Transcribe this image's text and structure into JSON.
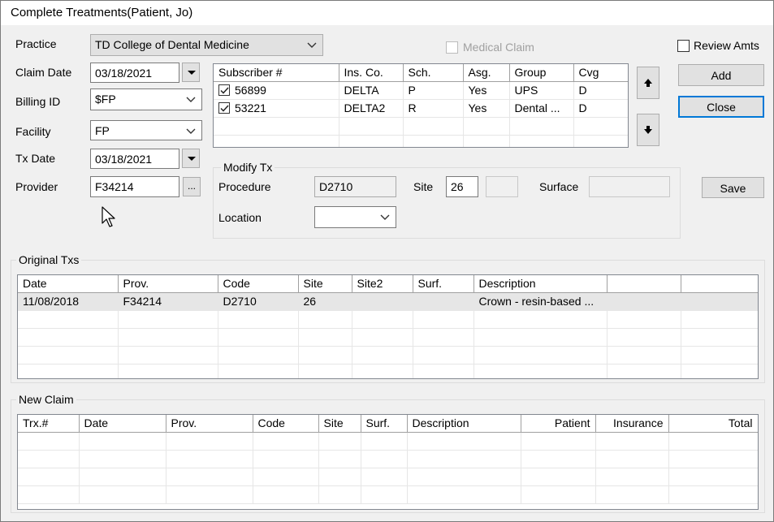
{
  "window": {
    "title": "Complete Treatments(Patient, Jo)"
  },
  "form": {
    "practice_label": "Practice",
    "practice_value": "TD College of Dental Medicine",
    "claim_date_label": "Claim Date",
    "claim_date_value": "03/18/2021",
    "billing_id_label": "Billing ID",
    "billing_id_value": "$FP",
    "facility_label": "Facility",
    "facility_value": "FP",
    "tx_date_label": "Tx Date",
    "tx_date_value": "03/18/2021",
    "provider_label": "Provider",
    "provider_value": "F34214",
    "provider_browse": "..."
  },
  "medical_claim": {
    "label": "Medical Claim",
    "checked": false,
    "enabled": false
  },
  "review_amts": {
    "label": "Review Amts",
    "checked": false
  },
  "buttons": {
    "add": "Add",
    "close": "Close",
    "save": "Save"
  },
  "subscribers": {
    "columns": [
      "Subscriber #",
      "Ins. Co.",
      "Sch.",
      "Asg.",
      "Group",
      "Cvg"
    ],
    "rows": [
      {
        "checked": true,
        "cells": [
          "56899",
          "DELTA",
          "P",
          "Yes",
          "UPS",
          "D"
        ]
      },
      {
        "checked": true,
        "cells": [
          "53221",
          "DELTA2",
          "R",
          "Yes",
          "Dental ...",
          "D"
        ]
      }
    ]
  },
  "modify_tx": {
    "title": "Modify Tx",
    "procedure_label": "Procedure",
    "procedure_value": "D2710",
    "site_label": "Site",
    "site_value": "26",
    "site2_value": "",
    "surface_label": "Surface",
    "surface_value": "",
    "location_label": "Location",
    "location_value": ""
  },
  "original_txs": {
    "title": "Original Txs",
    "columns": [
      "Date",
      "Prov.",
      "Code",
      "Site",
      "Site2",
      "Surf.",
      "Description",
      "",
      ""
    ],
    "rows": [
      [
        "11/08/2018",
        "F34214",
        "D2710",
        "26",
        "",
        "",
        "Crown - resin-based ...",
        "",
        ""
      ]
    ]
  },
  "new_claim": {
    "title": "New Claim",
    "columns": [
      "Trx.#",
      "Date",
      "Prov.",
      "Code",
      "Site",
      "Surf.",
      "Description",
      "Patient",
      "Insurance",
      "Total"
    ],
    "rows": []
  },
  "icons": {
    "chevron": "chevron-down-icon",
    "up": "arrow-up-icon",
    "down": "arrow-down-icon",
    "cursor": "mouse-pointer-icon"
  }
}
